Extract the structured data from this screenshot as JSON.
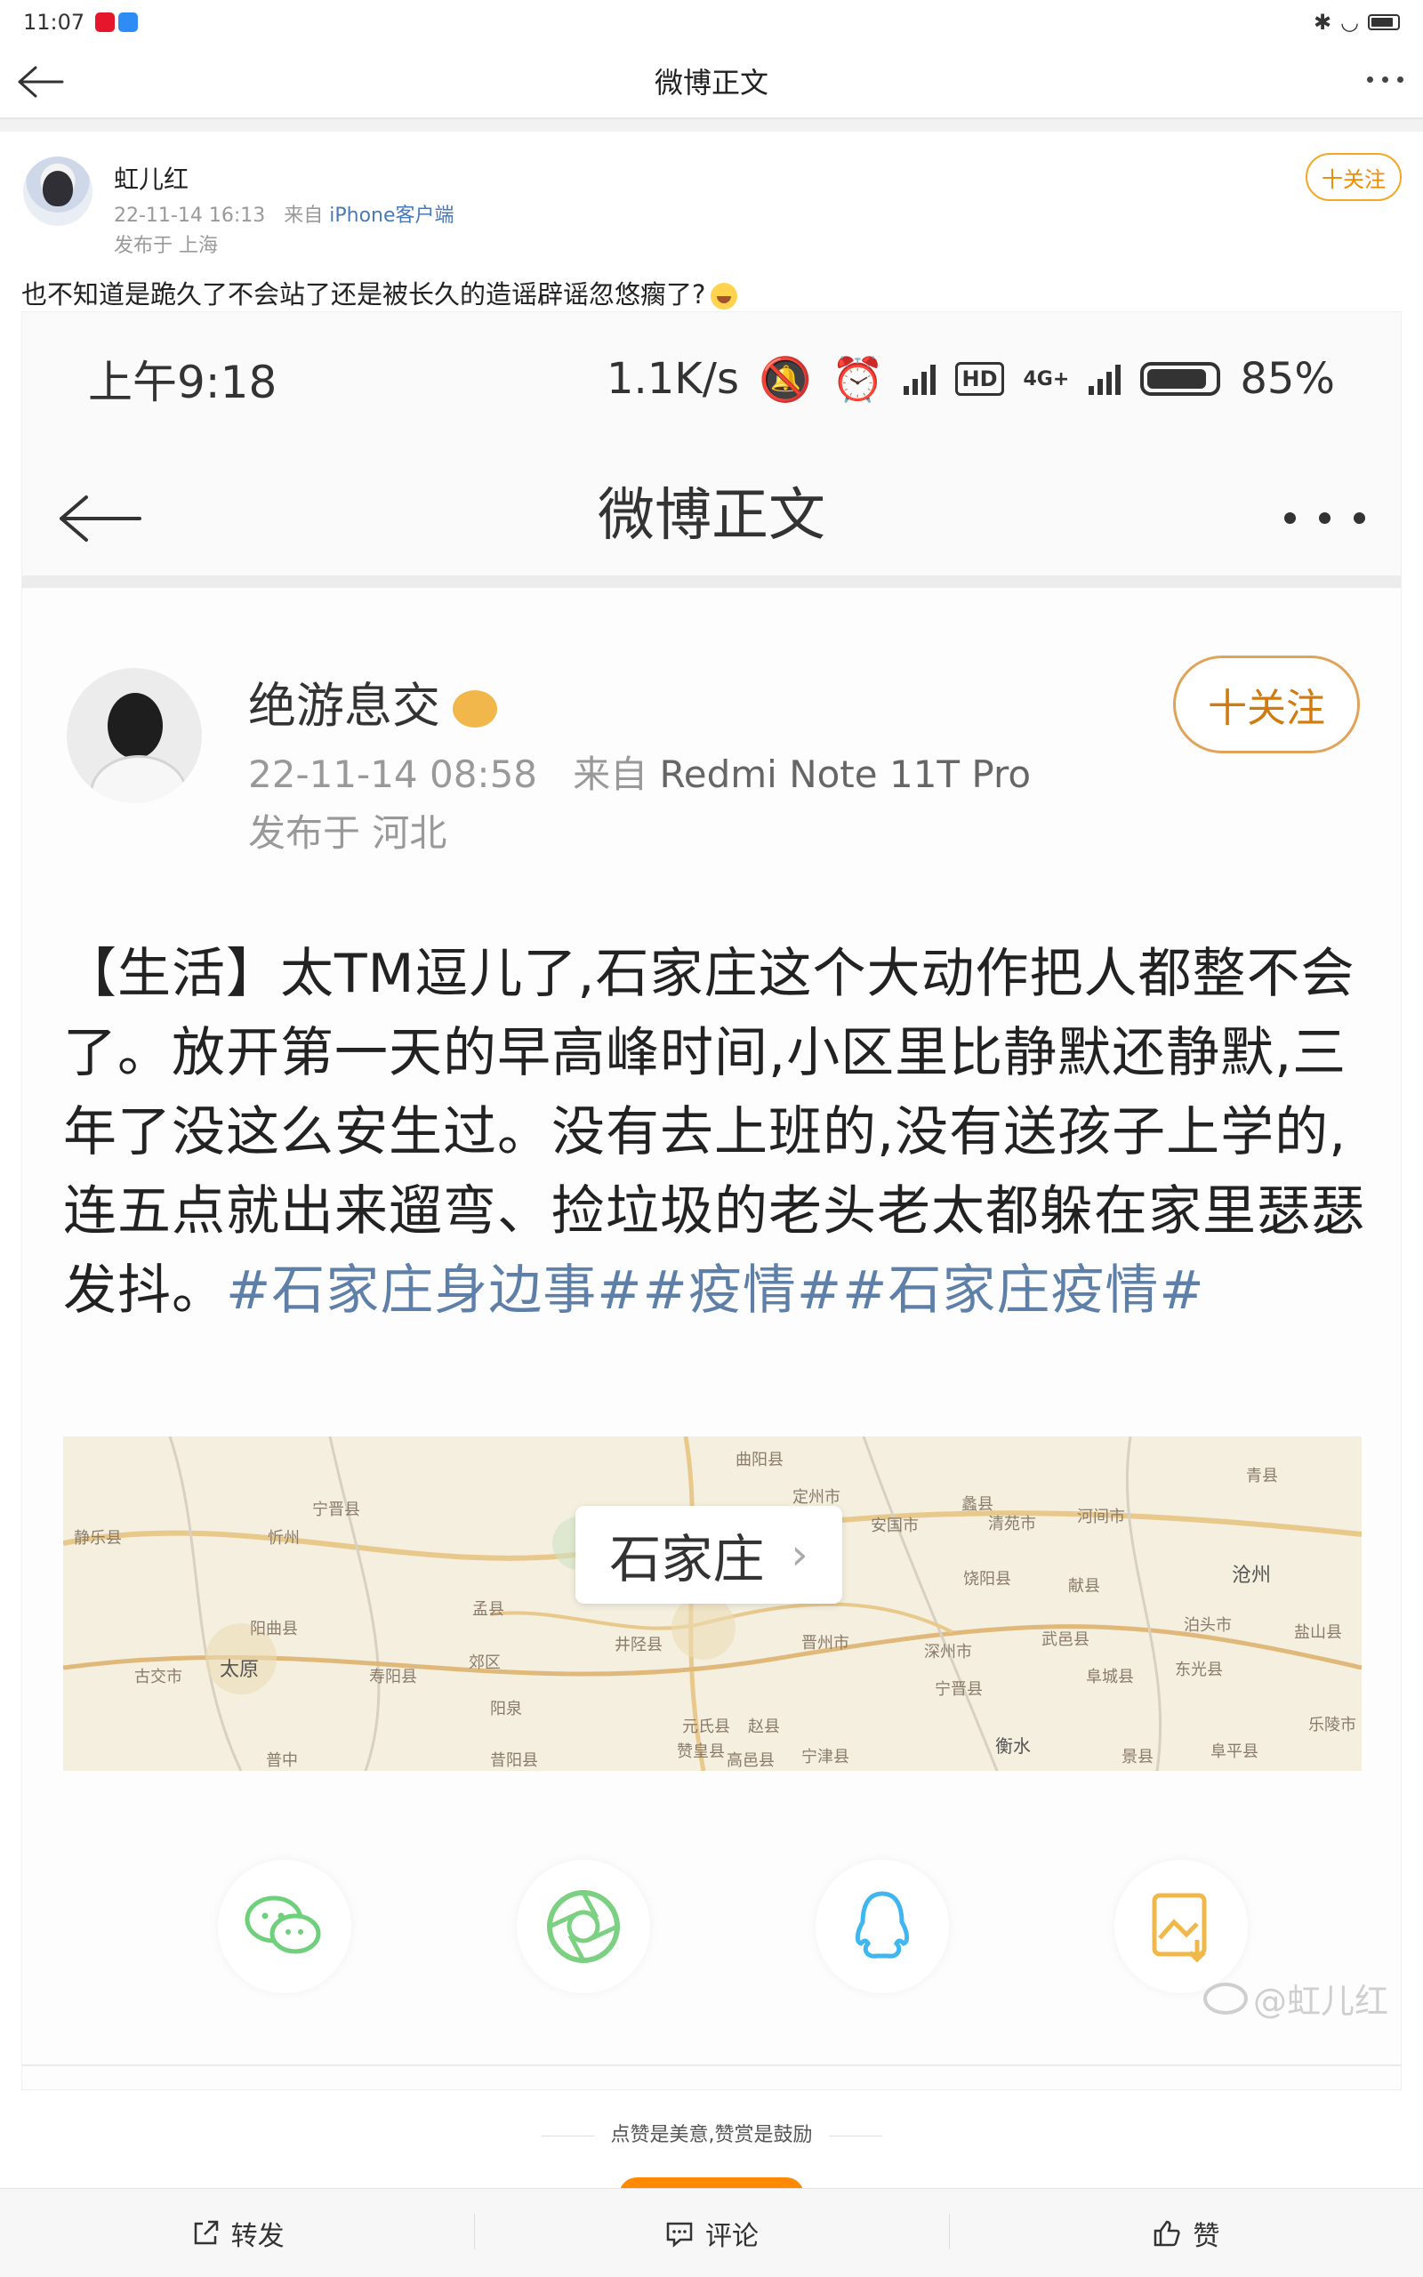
{
  "status_bar": {
    "time": "11:07"
  },
  "nav": {
    "title": "微博正文"
  },
  "post": {
    "author": "虹儿红",
    "timestamp": "22-11-14 16:13",
    "source_prefix": "来自",
    "source": "iPhone客户端",
    "location": "发布于 上海",
    "follow_label": "十关注",
    "text": "也不知道是跪久了不会站了还是被长久的造谣辟谣忽悠瘸了?"
  },
  "embedded": {
    "status": {
      "time": "上午9:18",
      "speed": "1.1K/s",
      "hd": "HD",
      "net": "4G+",
      "battery": "85%"
    },
    "nav_title": "微博正文",
    "author": "绝游息交",
    "timestamp": "22-11-14 08:58",
    "source_prefix": "来自",
    "source": "Redmi Note 11T Pro",
    "location": "发布于 河北",
    "follow_label": "十关注",
    "body": "【生活】太TM逗儿了,石家庄这个大动作把人都整不会了。放开第一天的早高峰时间,小区里比静默还静默,三年了没这么安生过。没有去上班的,没有送孩子上学的,连五点就出来遛弯、捡垃圾的老头老太都躲在家里瑟瑟发抖。",
    "tags": "#石家庄身边事##疫情##石家庄疫情#",
    "map_city": "石家庄",
    "map_places": [
      "曲阳县",
      "定州市",
      "蠡县",
      "青县",
      "静乐县",
      "忻州",
      "宁晋县",
      "安国市",
      "清苑市",
      "河间市",
      "沧州",
      "献县",
      "饶阳县",
      "泊头市",
      "盐山县",
      "阳曲县",
      "太原",
      "古交市",
      "寿阳县",
      "阳泉",
      "井陉县",
      "晋州市",
      "深州市",
      "武邑县",
      "阜城县",
      "东光县",
      "乐陵市",
      "赵县",
      "元氏县",
      "宁晋县",
      "衡水",
      "景县",
      "阜平县",
      "普中",
      "昔阳县",
      "赞皇县",
      "高邑县",
      "宁津县",
      "孟县",
      "郊区"
    ],
    "watermark": "@虹儿红"
  },
  "footer": {
    "tip": "点赞是美意,赞赏是鼓励",
    "repost": "转发",
    "comment": "评论",
    "like": "赞"
  },
  "colors": {
    "accent": "#f08a00",
    "link": "#4a7ab5",
    "tag": "#5d7fa8"
  },
  "icons": [
    "back-arrow-icon",
    "more-icon",
    "wechat-icon",
    "moments-icon",
    "qq-icon",
    "save-image-icon",
    "repost-icon",
    "comment-icon",
    "like-icon"
  ]
}
